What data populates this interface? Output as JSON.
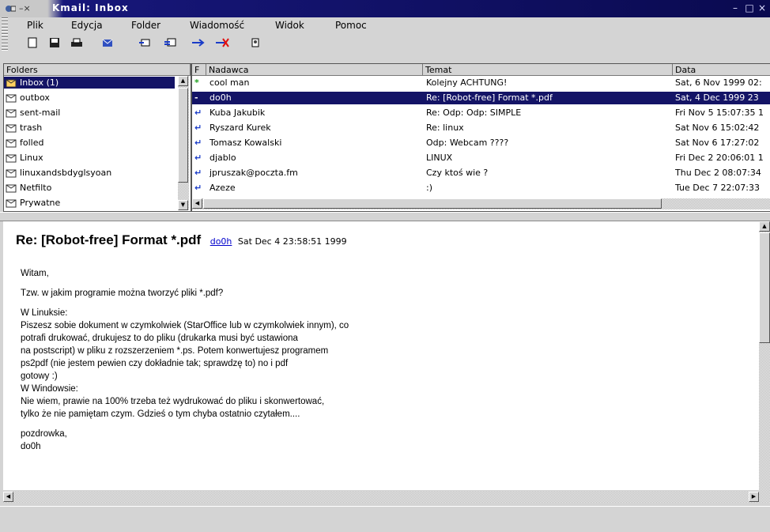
{
  "window": {
    "title": "Kmail: Inbox",
    "controls": [
      "–",
      "□",
      "×"
    ]
  },
  "menu": [
    "Plik",
    "Edycja",
    "Folder",
    "Wiadomość",
    "Widok",
    "Pomoc"
  ],
  "toolbar": [
    "new-mail-icon",
    "save-icon",
    "print-icon",
    "check-mail-icon",
    "reply-icon",
    "reply-all-icon",
    "forward-icon",
    "delete-icon",
    "addressbook-icon"
  ],
  "folders": {
    "header": "Folders",
    "items": [
      {
        "label": "Inbox (1)",
        "icon": "inbox-icon",
        "selected": true
      },
      {
        "label": "outbox",
        "icon": "outbox-icon"
      },
      {
        "label": "sent-mail",
        "icon": "sent-mail-icon"
      },
      {
        "label": "trash",
        "icon": "trash-icon"
      },
      {
        "label": "folled",
        "icon": "folder-icon"
      },
      {
        "label": "Linux",
        "icon": "folder-icon"
      },
      {
        "label": "linuxandsbdyglsyoan",
        "icon": "folder-icon"
      },
      {
        "label": "Netfilto",
        "icon": "folder-icon"
      },
      {
        "label": "Prywatne",
        "icon": "folder-icon"
      }
    ]
  },
  "messages": {
    "columns": [
      "F",
      "Nadawca",
      "Temat",
      "Data"
    ],
    "rows": [
      {
        "flag": "*",
        "sender": "cool man",
        "subject": "Kolejny ACHTUNG!",
        "date": "Sat, 6 Nov 1999 02:",
        "selected": false
      },
      {
        "flag": "-",
        "sender": "do0h",
        "subject": "Re: [Robot-free] Format *.pdf",
        "date": "Sat, 4 Dec 1999 23",
        "selected": true
      },
      {
        "flag": "↵",
        "sender": "Kuba Jakubik",
        "subject": "Re: Odp: Odp: SIMPLE",
        "date": "Fri Nov 5 15:07:35 1",
        "selected": false
      },
      {
        "flag": "↵",
        "sender": "Ryszard Kurek",
        "subject": "Re: linux",
        "date": "Sat Nov 6 15:02:42",
        "selected": false
      },
      {
        "flag": "↵",
        "sender": "Tomasz Kowalski",
        "subject": "Odp: Webcam ????",
        "date": "Sat Nov 6 17:27:02",
        "selected": false
      },
      {
        "flag": "↵",
        "sender": "djablo",
        "subject": "LINUX",
        "date": "Fri Dec 2 20:06:01 1",
        "selected": false
      },
      {
        "flag": "↵",
        "sender": "jpruszak@poczta.fm",
        "subject": "Czy ktoś wie ?",
        "date": "Thu Dec 2 08:07:34",
        "selected": false
      },
      {
        "flag": "↵",
        "sender": "Azeze",
        "subject": ":)",
        "date": "Tue Dec 7 22:07:33",
        "selected": false
      }
    ]
  },
  "preview": {
    "subject": "Re: [Robot-free] Format *.pdf",
    "from": "do0h",
    "date": "Sat Dec 4 23:58:51 1999",
    "paragraphs": [
      "Witam,",
      "Tzw. w jakim programie można tworzyć pliki *.pdf?",
      "W Linuksie:\nPiszesz sobie dokument w czymkolwiek (StarOffice lub w czymkolwiek innym), co\npotrafi drukować, drukujesz to do pliku (drukarka musi być ustawiona\nna postscript) w pliku z rozszerzeniem *.ps. Potem konwertujesz programem\nps2pdf (nie jestem pewien czy dokładnie tak; sprawdzę to) no i pdf\ngotowy :)\nW Windowsie:\nNie wiem, prawie na 100% trzeba też wydrukować do pliku i skonwertować,\ntylko że nie pamiętam czym. Gdzieś o tym chyba ostatnio czytałem....",
      "pozdrowka,\ndo0h"
    ]
  }
}
